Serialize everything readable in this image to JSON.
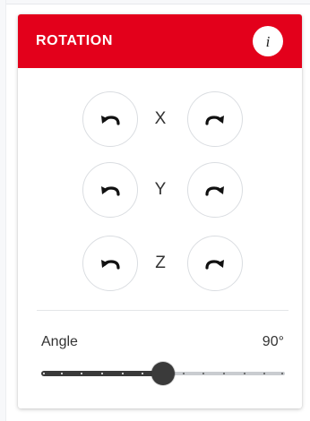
{
  "panel": {
    "title": "ROTATION",
    "info_icon": "info-icon",
    "info_glyph": "i",
    "accent_color": "#e3001b"
  },
  "rotation": {
    "axes": [
      {
        "label": "X",
        "left_icon": "rotate-counterclockwise-icon",
        "right_icon": "rotate-clockwise-icon"
      },
      {
        "label": "Y",
        "left_icon": "rotate-counterclockwise-icon",
        "right_icon": "rotate-clockwise-icon"
      },
      {
        "label": "Z",
        "left_icon": "rotate-counterclockwise-icon",
        "right_icon": "rotate-clockwise-icon"
      }
    ]
  },
  "angle": {
    "label": "Angle",
    "value_text": "90°",
    "value": 90,
    "min": 0,
    "max": 180,
    "step": 15,
    "fill_color": "#3a3a3a",
    "rest_color": "#c9ccd0"
  }
}
